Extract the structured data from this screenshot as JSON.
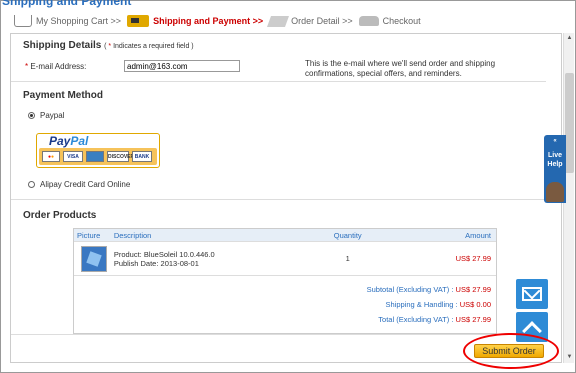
{
  "page": {
    "partial_title": "Shipping and Payment"
  },
  "steps": [
    {
      "label": "My Shopping Cart >>",
      "icon": "cart-icon"
    },
    {
      "label": "Shipping and Payment >>",
      "icon": "truck-icon",
      "active": true
    },
    {
      "label": "Order Detail >>",
      "icon": "tag-icon"
    },
    {
      "label": "Checkout",
      "icon": "car-icon"
    }
  ],
  "shipping": {
    "title": "Shipping Details",
    "required_note": "( * Indicates a required field )",
    "required_note_star": "*",
    "required_note_text": " Indicates a required field )",
    "email_label": "E-mail Address:",
    "email_value": "admin@163.com",
    "email_note": "This is the e-mail where we'll send order and shipping confirmations, special offers, and reminders."
  },
  "payment": {
    "title": "Payment Method",
    "options": [
      {
        "label": "Paypal",
        "selected": true
      },
      {
        "label": "Alipay Credit Card Online",
        "selected": false
      }
    ],
    "paypal_logo": {
      "pay": "Pay",
      "pal": "Pal",
      "cards": [
        "MasterCard",
        "VISA",
        "AMEX",
        "DISCOVER",
        "BANK"
      ]
    }
  },
  "order": {
    "title": "Order Products",
    "columns": [
      "Picture",
      "Description",
      "Quantity",
      "Amount"
    ],
    "items": [
      {
        "product": "Product: BlueSoleil 10.0.446.0",
        "publish": "Publish Date: 2013-08-01",
        "quantity": "1",
        "amount": "US$ 27.99"
      }
    ],
    "totals": [
      {
        "label": "Subtotal (Excluding VAT) :",
        "value": "US$ 27.99"
      },
      {
        "label": "Shipping & Handling :",
        "value": "US$ 0.00"
      },
      {
        "label": "Total (Excluding VAT) :",
        "value": "US$ 27.99"
      }
    ]
  },
  "live_help": {
    "line1": "Live",
    "line2": "Help",
    "arrow": "«"
  },
  "submit": {
    "label": "Submit Order"
  },
  "colors": {
    "accent": "#2a6ebd",
    "price": "#cc0000",
    "button": "#f0a800",
    "highlight": "#ee0000"
  }
}
